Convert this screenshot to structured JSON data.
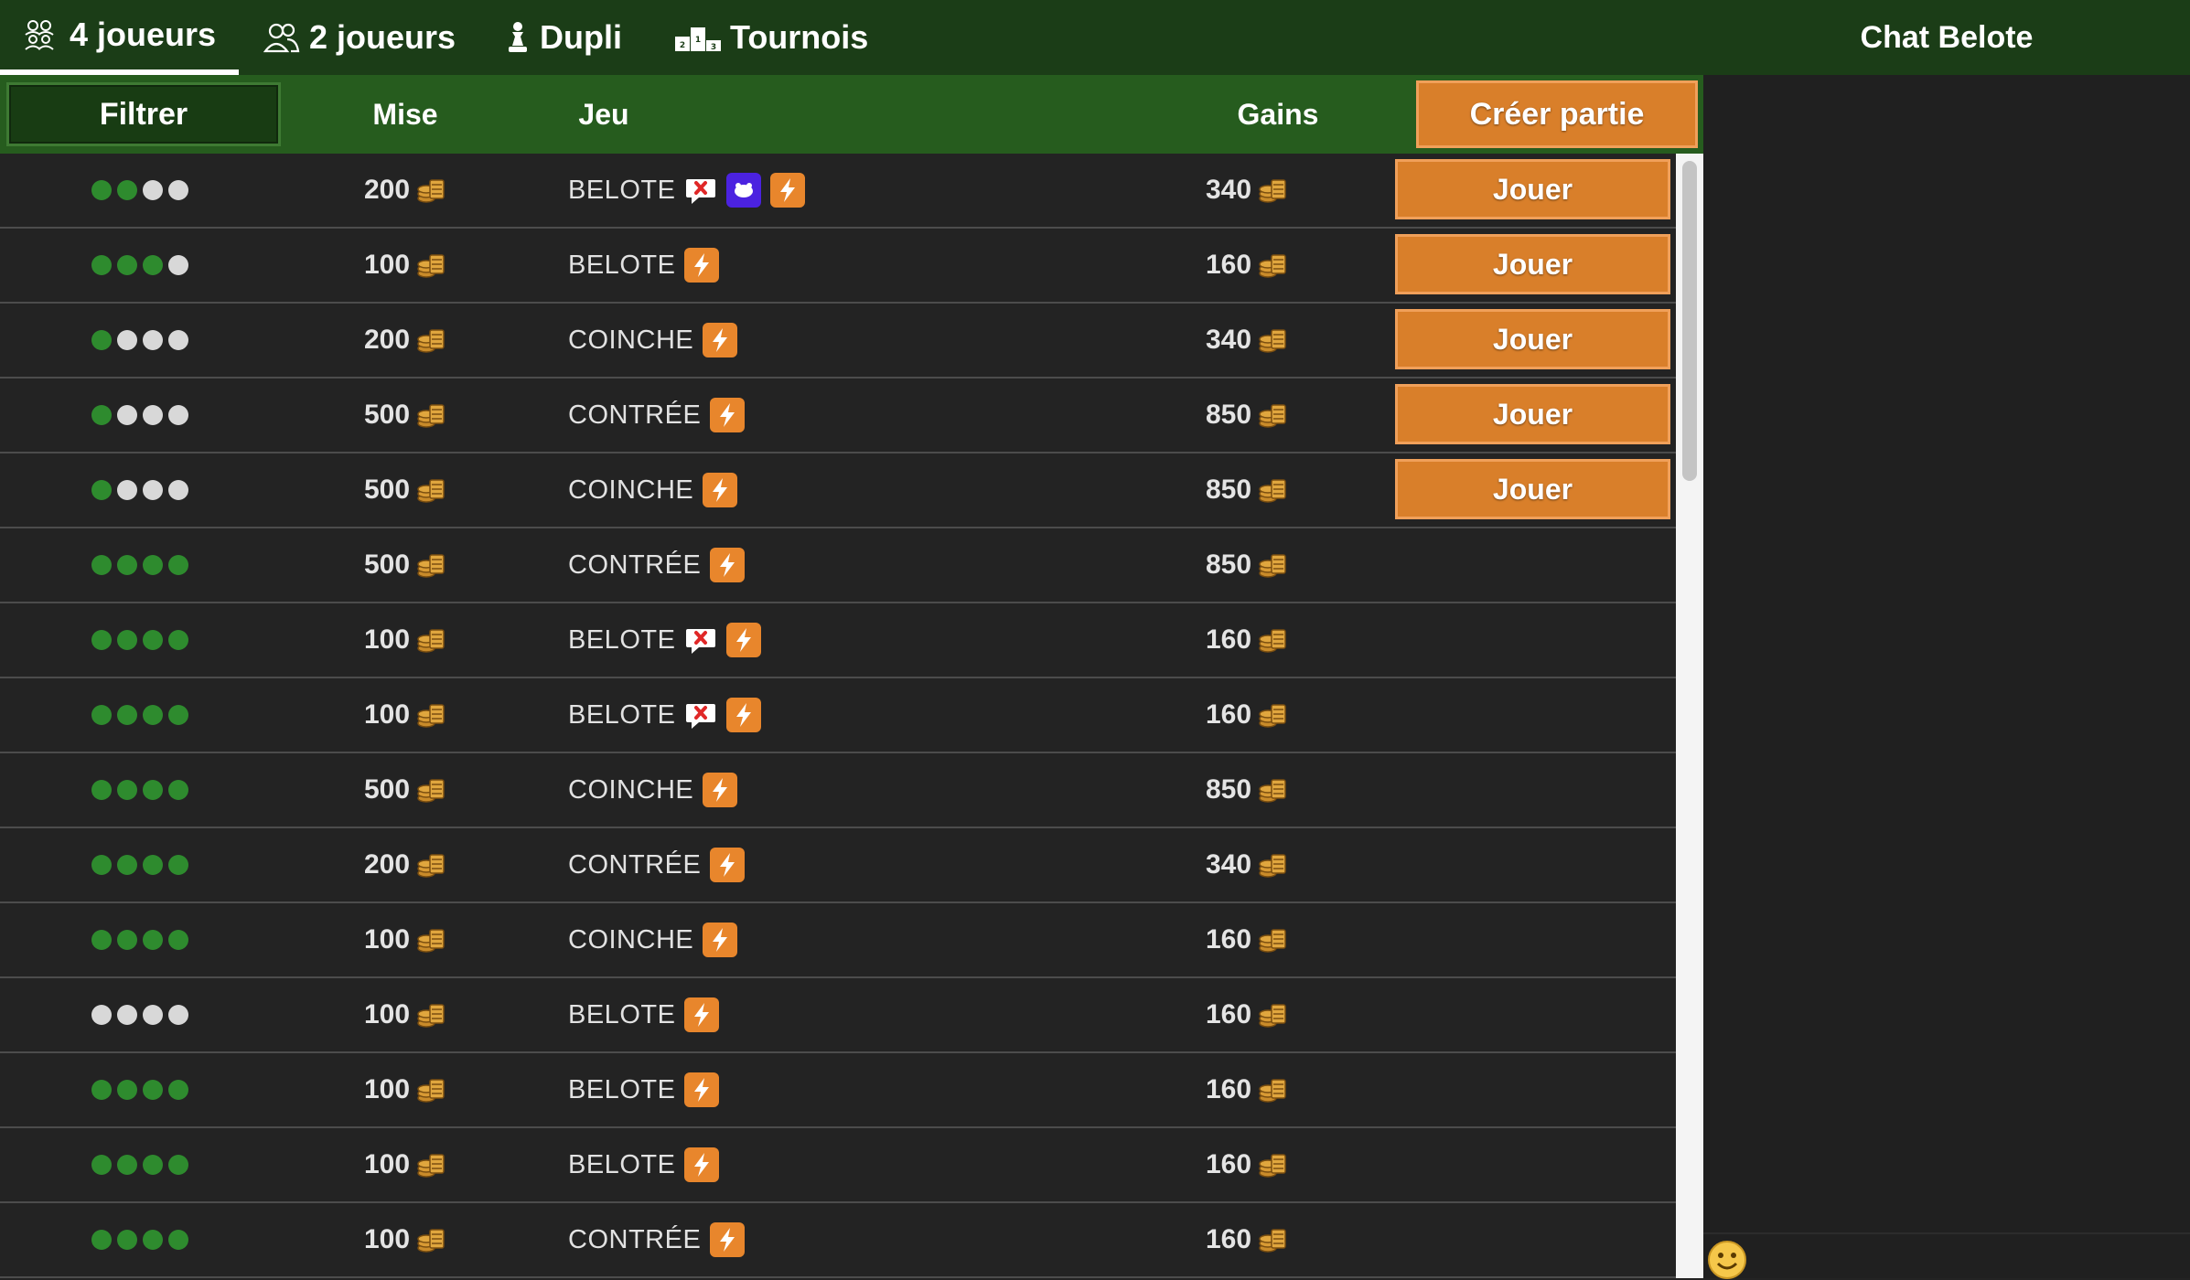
{
  "nav": {
    "tabs": [
      {
        "label": "4 joueurs",
        "icon": "four-players-icon",
        "active": true
      },
      {
        "label": "2 joueurs",
        "icon": "two-players-icon",
        "active": false
      },
      {
        "label": "Dupli",
        "icon": "chess-piece-icon",
        "active": false
      },
      {
        "label": "Tournois",
        "icon": "podium-icon",
        "active": false
      }
    ],
    "chat_title": "Chat Belote"
  },
  "header": {
    "filter_label": "Filtrer",
    "mise_label": "Mise",
    "jeu_label": "Jeu",
    "gains_label": "Gains",
    "create_label": "Créer partie"
  },
  "play_label": "Jouer",
  "colors": {
    "accent": "#d97f2a",
    "topbar": "#1b3d17",
    "header": "#265c1e",
    "seat_taken": "#2e8b2e",
    "seat_free": "#d8d8d8"
  },
  "games": [
    {
      "seats": [
        "g",
        "g",
        "w",
        "w"
      ],
      "mise": "200",
      "jeu": "BELOTE",
      "icons": [
        "no-announce-icon",
        "purple-badge-icon",
        "lightning-icon"
      ],
      "gains": "340",
      "joinable": true
    },
    {
      "seats": [
        "g",
        "g",
        "g",
        "w"
      ],
      "mise": "100",
      "jeu": "BELOTE",
      "icons": [
        "lightning-icon"
      ],
      "gains": "160",
      "joinable": true
    },
    {
      "seats": [
        "g",
        "w",
        "w",
        "w"
      ],
      "mise": "200",
      "jeu": "COINCHE",
      "icons": [
        "lightning-icon"
      ],
      "gains": "340",
      "joinable": true
    },
    {
      "seats": [
        "g",
        "w",
        "w",
        "w"
      ],
      "mise": "500",
      "jeu": "CONTRÉE",
      "icons": [
        "lightning-icon"
      ],
      "gains": "850",
      "joinable": true
    },
    {
      "seats": [
        "g",
        "w",
        "w",
        "w"
      ],
      "mise": "500",
      "jeu": "COINCHE",
      "icons": [
        "lightning-icon"
      ],
      "gains": "850",
      "joinable": true
    },
    {
      "seats": [
        "g",
        "g",
        "g",
        "g"
      ],
      "mise": "500",
      "jeu": "CONTRÉE",
      "icons": [
        "lightning-icon"
      ],
      "gains": "850",
      "joinable": false
    },
    {
      "seats": [
        "g",
        "g",
        "g",
        "g"
      ],
      "mise": "100",
      "jeu": "BELOTE",
      "icons": [
        "no-announce-icon",
        "lightning-icon"
      ],
      "gains": "160",
      "joinable": false
    },
    {
      "seats": [
        "g",
        "g",
        "g",
        "g"
      ],
      "mise": "100",
      "jeu": "BELOTE",
      "icons": [
        "no-announce-icon",
        "lightning-icon"
      ],
      "gains": "160",
      "joinable": false
    },
    {
      "seats": [
        "g",
        "g",
        "g",
        "g"
      ],
      "mise": "500",
      "jeu": "COINCHE",
      "icons": [
        "lightning-icon"
      ],
      "gains": "850",
      "joinable": false
    },
    {
      "seats": [
        "g",
        "g",
        "g",
        "g"
      ],
      "mise": "200",
      "jeu": "CONTRÉE",
      "icons": [
        "lightning-icon"
      ],
      "gains": "340",
      "joinable": false
    },
    {
      "seats": [
        "g",
        "g",
        "g",
        "g"
      ],
      "mise": "100",
      "jeu": "COINCHE",
      "icons": [
        "lightning-icon"
      ],
      "gains": "160",
      "joinable": false
    },
    {
      "seats": [
        "w",
        "w",
        "w",
        "w"
      ],
      "mise": "100",
      "jeu": "BELOTE",
      "icons": [
        "lightning-icon"
      ],
      "gains": "160",
      "joinable": false
    },
    {
      "seats": [
        "g",
        "g",
        "g",
        "g"
      ],
      "mise": "100",
      "jeu": "BELOTE",
      "icons": [
        "lightning-icon"
      ],
      "gains": "160",
      "joinable": false
    },
    {
      "seats": [
        "g",
        "g",
        "g",
        "g"
      ],
      "mise": "100",
      "jeu": "BELOTE",
      "icons": [
        "lightning-icon"
      ],
      "gains": "160",
      "joinable": false
    },
    {
      "seats": [
        "g",
        "g",
        "g",
        "g"
      ],
      "mise": "100",
      "jeu": "CONTRÉE",
      "icons": [
        "lightning-icon"
      ],
      "gains": "160",
      "joinable": false
    }
  ]
}
